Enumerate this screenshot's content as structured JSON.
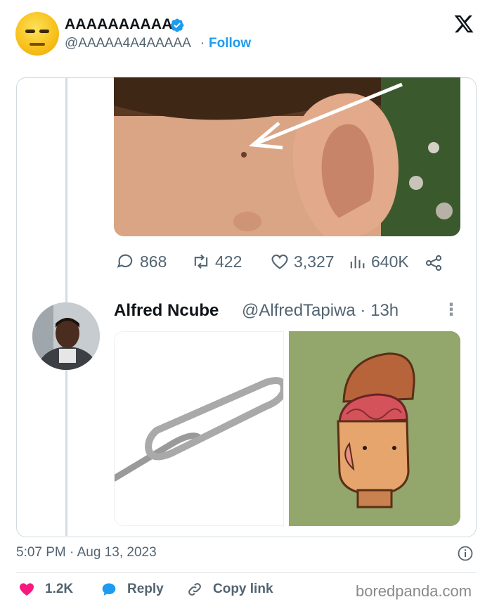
{
  "header": {
    "display_name": "AAAAAAAAAA",
    "handle": "@AAAAA4A4AAAAA",
    "separator": "·",
    "follow_label": "Follow"
  },
  "tweet_screenshot": {
    "stats": {
      "replies": "868",
      "retweets": "422",
      "likes": "3,327",
      "views": "640K"
    },
    "reply": {
      "name": "Alfred Ncube",
      "handle_time": "@AlfredTapiwa · 13h",
      "more": "⋮"
    }
  },
  "footer": {
    "timestamp": "5:07 PM · Aug 13, 2023",
    "like_count": "1.2K",
    "reply_label": "Reply",
    "copy_link_label": "Copy link"
  },
  "watermark": "boredpanda.com",
  "colors": {
    "accent": "#1d9bf0",
    "like": "#f91880",
    "secondary_text": "#536471"
  }
}
